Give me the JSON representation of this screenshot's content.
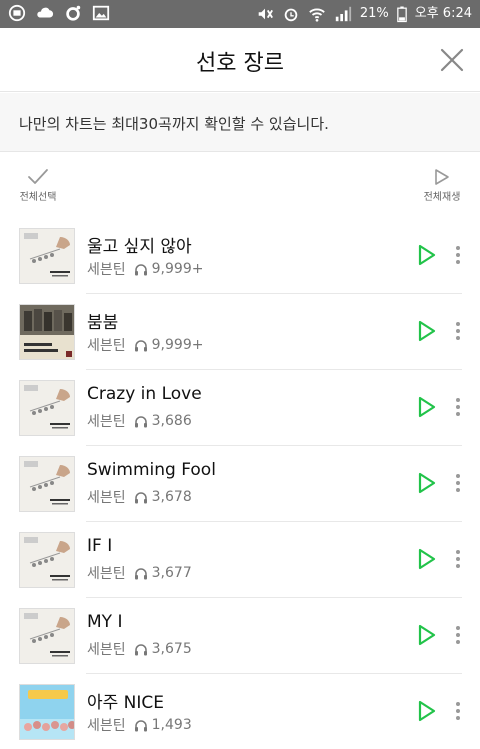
{
  "status_bar": {
    "battery": "21%",
    "time": "오후 6:24",
    "icons": [
      "app-icon",
      "cloud-icon",
      "circle-icon",
      "image-icon",
      "mute-icon",
      "alarm-icon",
      "wifi-icon",
      "signal-icon",
      "battery-icon"
    ]
  },
  "header": {
    "title": "선호 장르"
  },
  "notice": {
    "text": "나만의 차트는 최대30곡까지 확인할 수 있습니다."
  },
  "controls": {
    "select_all": "전체선택",
    "play_all": "전체재생"
  },
  "colors": {
    "accent_green": "#22c34a",
    "statusbar": "#6b6b6b"
  },
  "songs": [
    {
      "title": "울고 싶지 않아",
      "artist": "세븐틴",
      "plays": "9,999+"
    },
    {
      "title": "붐붐",
      "artist": "세븐틴",
      "plays": "9,999+"
    },
    {
      "title": "Crazy in Love",
      "artist": "세븐틴",
      "plays": "3,686"
    },
    {
      "title": "Swimming Fool",
      "artist": "세븐틴",
      "plays": "3,678"
    },
    {
      "title": "IF I",
      "artist": "세븐틴",
      "plays": "3,677"
    },
    {
      "title": "MY I",
      "artist": "세븐틴",
      "plays": "3,675"
    },
    {
      "title": "아주 NICE",
      "artist": "세븐틴",
      "plays": "1,493"
    }
  ]
}
